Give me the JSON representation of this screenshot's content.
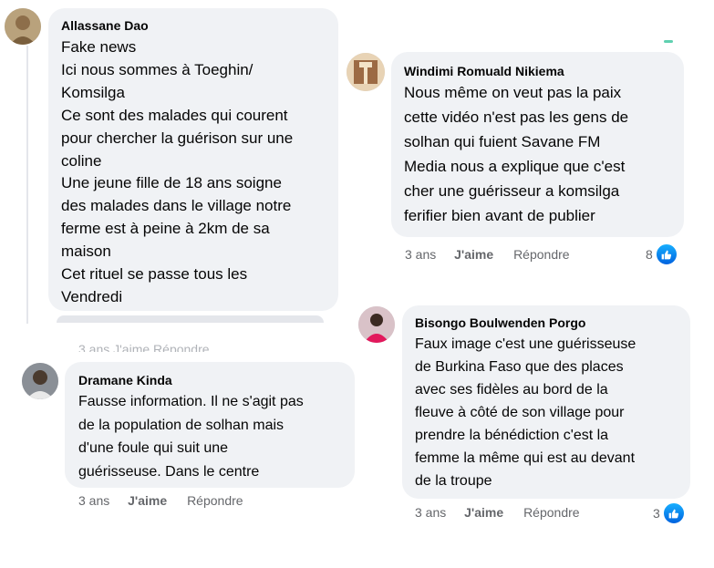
{
  "comments": [
    {
      "author": "Allassane Dao",
      "text": "Fake news\nIci nous sommes à Toeghin/\nKomsilga\nCe sont des malades qui courent\npour chercher la guérison sur une\ncoline\nUne jeune fille de 18 ans soigne\ndes malades dans le village notre\nferme est à peine à 2km de sa\nmaison\nCet rituel se passe tous les\nVendredi",
      "actions_partial": "3 ans   J'aime   Répondre"
    },
    {
      "author": "Windimi Romuald Nikiema",
      "text": "Nous même on veut pas la paix\ncette vidéo n'est pas les gens de\nsolhan qui fuient Savane FM\nMedia nous a explique que c'est\ncher une guérisseur a komsilga\nferifier bien avant de publier",
      "time": "3 ans",
      "like": "J'aime",
      "reply": "Répondre",
      "reaction_count": "8"
    },
    {
      "author": "Dramane Kinda",
      "text": "Fausse information. Il ne s'agit pas\nde la population de solhan mais\nd'une foule qui suit une\nguérisseuse. Dans le centre",
      "time": "3 ans",
      "like": "J'aime",
      "reply": "Répondre"
    },
    {
      "author": "Bisongo Boulwenden Porgo",
      "text": "Faux image c'est une guérisseuse\nde Burkina Faso que des places\navec ses fidèles au bord de la\nfleuve à côté de son village pour\nprendre la bénédiction c'est la\nfemme la même qui est au devant\nde la troupe",
      "time": "3 ans",
      "like": "J'aime",
      "reply": "Répondre",
      "reaction_count": "3"
    }
  ],
  "icons": {
    "reaction": "like-thumb-icon"
  },
  "colors": {
    "bubble": "#f0f2f5",
    "meta_text": "#65676b",
    "like_blue": "#1877f2"
  }
}
